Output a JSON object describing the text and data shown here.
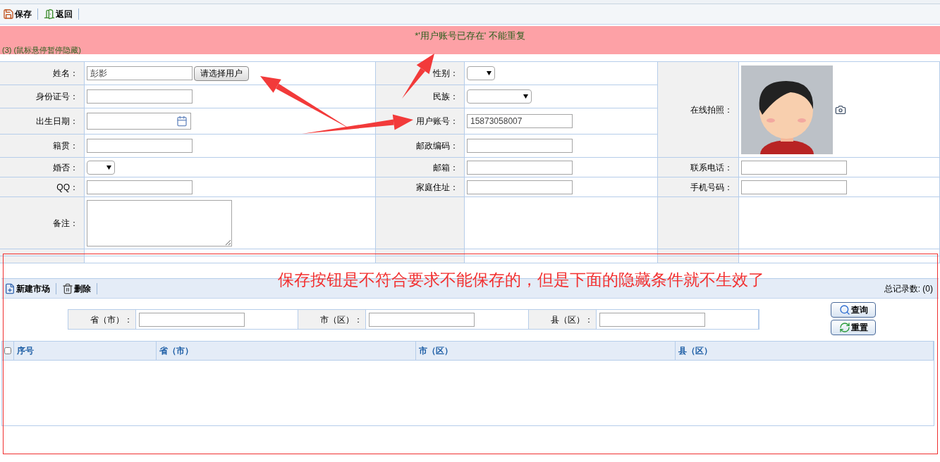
{
  "toolbar": {
    "buttons": [
      {
        "label": "保存",
        "kind": "save"
      },
      {
        "label": "返回",
        "kind": "back"
      }
    ]
  },
  "alert": {
    "message": "*'用户账号已存在' 不能重复",
    "countdown": "(3) (鼠标悬停暂停隐藏)"
  },
  "form": {
    "rows": [
      [
        {
          "label": "姓名：",
          "kind": "text_button",
          "value": "彭影",
          "button": "请选择用户"
        },
        {
          "label": "性别：",
          "kind": "select_short"
        },
        {
          "label": "在线拍照：",
          "rowspan": 4
        }
      ],
      [
        {
          "label": "身份证号：",
          "kind": "text"
        },
        {
          "label": "民族：",
          "kind": "select"
        }
      ],
      [
        {
          "label": "出生日期：",
          "kind": "date"
        },
        {
          "label": "用户账号：",
          "kind": "text",
          "value": "15873058007"
        }
      ],
      [
        {
          "label": "籍贯：",
          "kind": "text"
        },
        {
          "label": "邮政编码：",
          "kind": "text"
        }
      ],
      [
        {
          "label": "婚否：",
          "kind": "select_short"
        },
        {
          "label": "邮箱：",
          "kind": "text"
        },
        {
          "label": "联系电话：",
          "kind": "text"
        }
      ],
      [
        {
          "label": "QQ：",
          "kind": "text"
        },
        {
          "label": "家庭住址：",
          "kind": "text"
        },
        {
          "label": "手机号码：",
          "kind": "text"
        }
      ],
      [
        {
          "label": "备注：",
          "kind": "textarea"
        },
        {
          "kind": "none"
        },
        {
          "kind": "none"
        }
      ]
    ]
  },
  "market": {
    "toolbar": [
      {
        "label": "新建市场",
        "kind": "new"
      },
      {
        "label": "删除",
        "kind": "delete"
      }
    ],
    "record_count": "总记录数: (0)",
    "filters": [
      {
        "label": "省（市）："
      },
      {
        "label": "市（区）："
      },
      {
        "label": "县（区）："
      }
    ],
    "actions": [
      {
        "label": "查询",
        "kind": "search"
      },
      {
        "label": "重置",
        "kind": "reset"
      }
    ],
    "columns": [
      "序号",
      "省（市）",
      "市（区）",
      "县（区）"
    ],
    "select_all": false
  },
  "annotation": {
    "note": "保存按钮是不符合要求不能保存的，但是下面的隐藏条件就不生效了"
  }
}
